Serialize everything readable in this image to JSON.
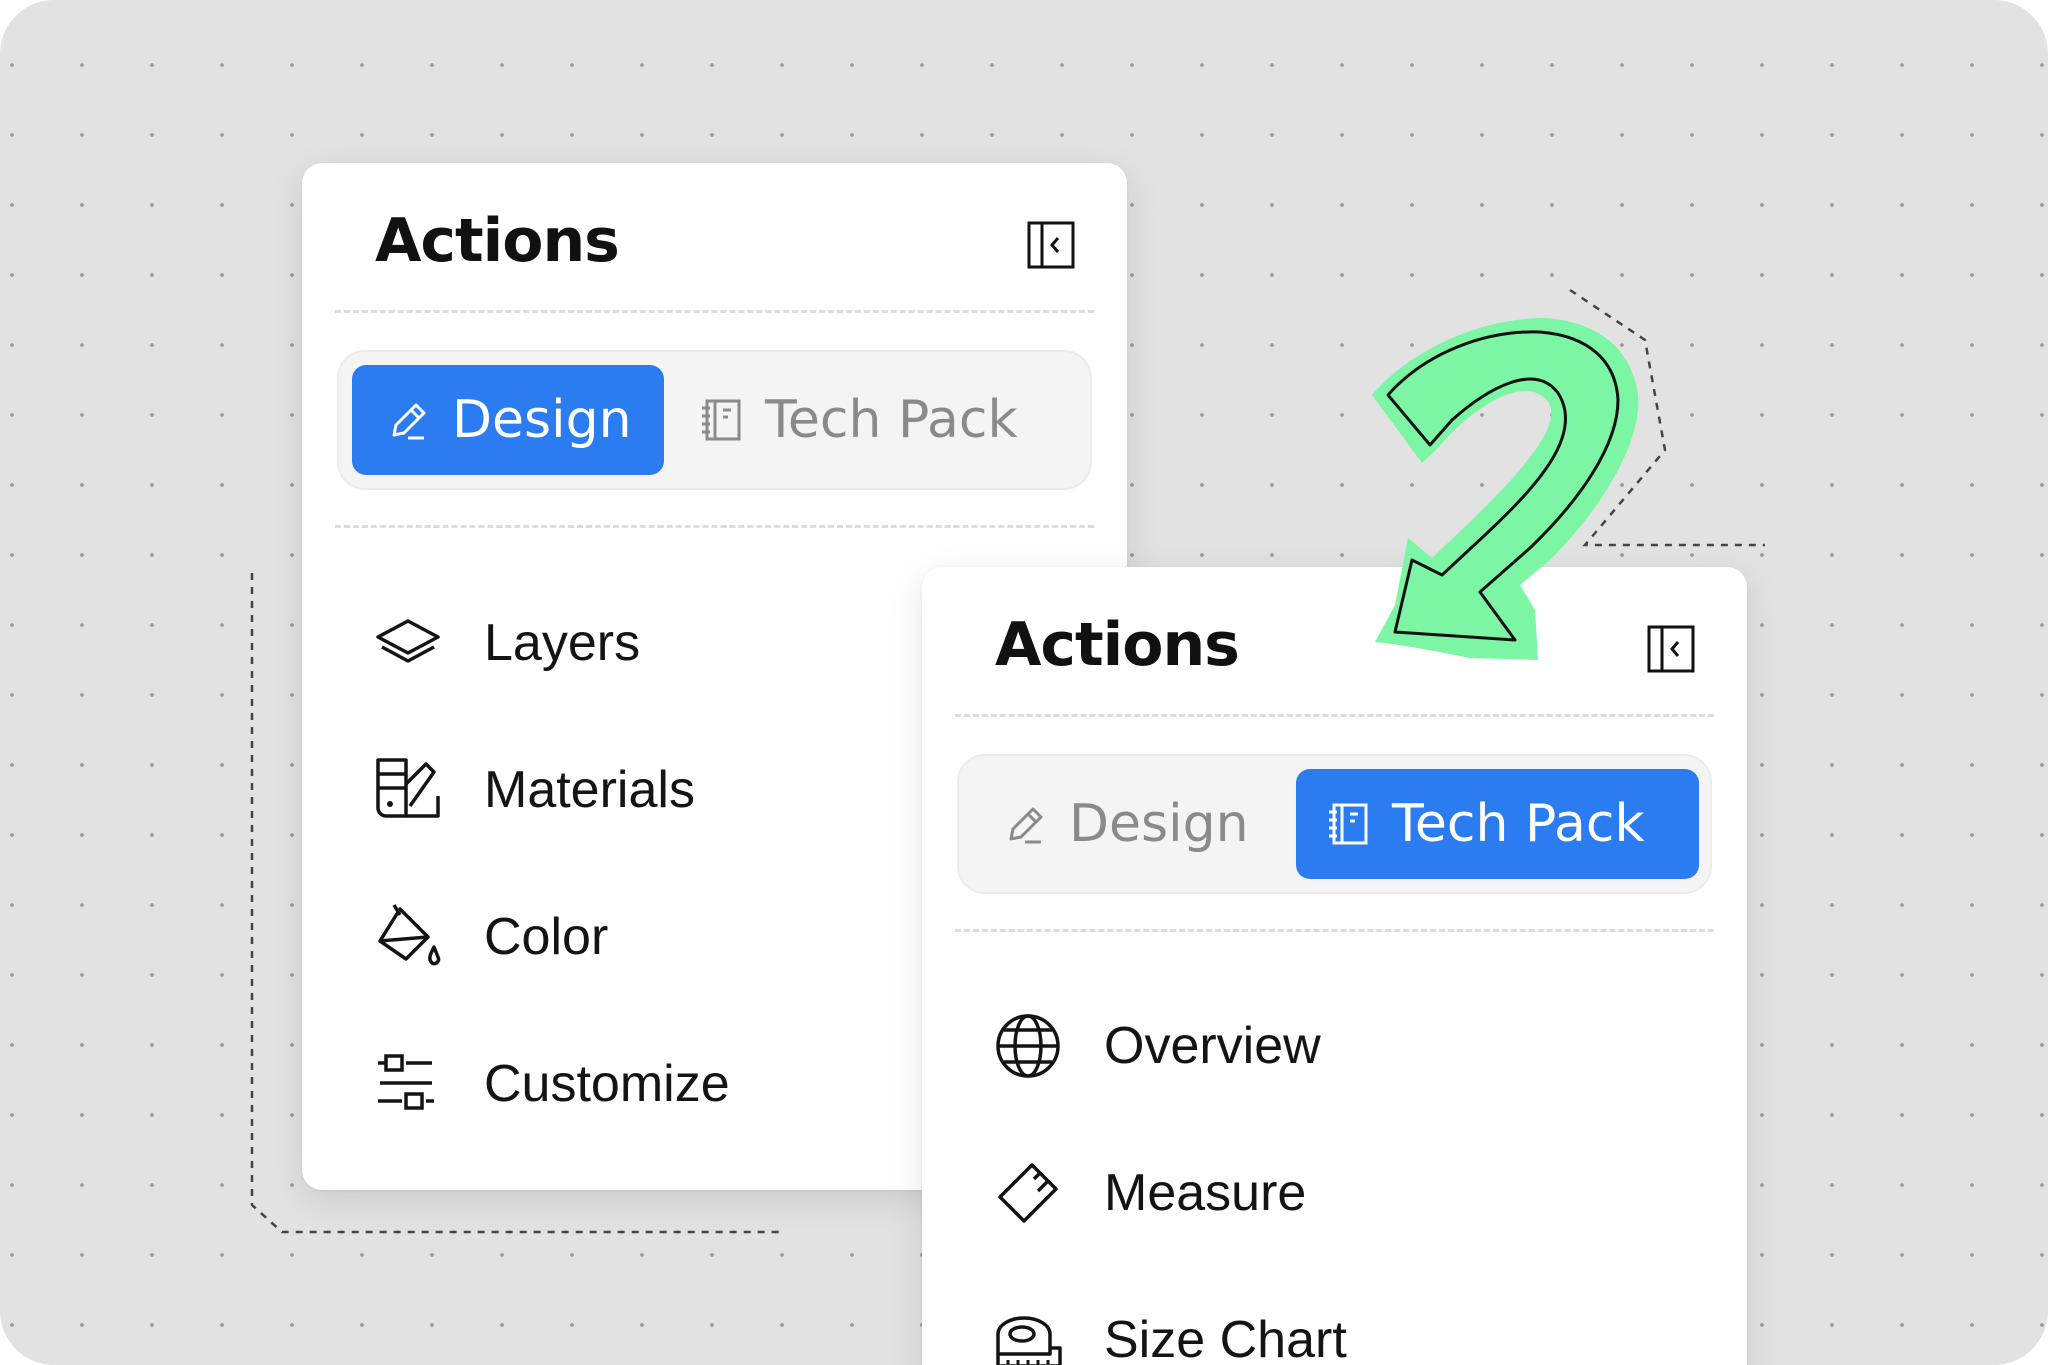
{
  "panels": [
    {
      "title": "Actions",
      "tabs": [
        {
          "label": "Design",
          "icon": "pencil-icon",
          "active": true
        },
        {
          "label": "Tech Pack",
          "icon": "notebook-icon",
          "active": false
        }
      ],
      "items": [
        {
          "label": "Layers",
          "icon": "layers-icon"
        },
        {
          "label": "Materials",
          "icon": "materials-icon"
        },
        {
          "label": "Color",
          "icon": "paint-bucket-icon"
        },
        {
          "label": "Customize",
          "icon": "customize-icon"
        }
      ]
    },
    {
      "title": "Actions",
      "tabs": [
        {
          "label": "Design",
          "icon": "pencil-icon",
          "active": false
        },
        {
          "label": "Tech Pack",
          "icon": "notebook-icon",
          "active": true
        }
      ],
      "items": [
        {
          "label": "Overview",
          "icon": "globe-icon"
        },
        {
          "label": "Measure",
          "icon": "ruler-icon"
        },
        {
          "label": "Size Chart",
          "icon": "tape-measure-icon"
        }
      ]
    }
  ],
  "colors": {
    "accent": "#2b7cf0",
    "arrow": "#7cf5a4",
    "background": "#e2e2e2"
  }
}
